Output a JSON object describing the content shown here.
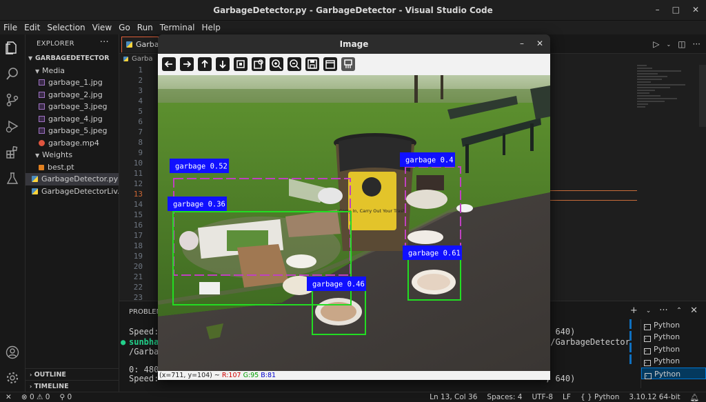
{
  "window": {
    "title": "GarbageDetector.py - GarbageDetector - Visual Studio Code",
    "controls": [
      "–",
      "□",
      "✕"
    ]
  },
  "menu": [
    "File",
    "Edit",
    "Selection",
    "View",
    "Go",
    "Run",
    "Terminal",
    "Help"
  ],
  "activity_bar": [
    "files-icon",
    "search-icon",
    "source-control-icon",
    "run-debug-icon",
    "extensions-icon",
    "testing-icon",
    "account-icon",
    "settings-gear-icon"
  ],
  "explorer": {
    "header": "EXPLORER",
    "root": "GARBAGEDETECTOR",
    "folders": [
      {
        "name": "Media",
        "files": [
          "garbage_1.jpg",
          "garbage_2.jpg",
          "garbage_3.jpeg",
          "garbage_4.jpg",
          "garbage_5.jpeg",
          "garbage.mp4"
        ]
      },
      {
        "name": "Weights",
        "files": [
          "best.pt"
        ]
      }
    ],
    "root_files": [
      "GarbageDetector.py",
      "GarbageDetectorLiv..."
    ],
    "sections": [
      "OUTLINE",
      "TIMELINE"
    ]
  },
  "editor": {
    "tab": "GarbageDetector.py",
    "tab_visible": "Garbag",
    "breadcrumb": "Garba",
    "line_numbers": [
      "1",
      "2",
      "3",
      "4",
      "5",
      "6",
      "7",
      "8",
      "9",
      "10",
      "11",
      "12",
      "13",
      "14",
      "15",
      "16",
      "17",
      "18",
      "19",
      "20",
      "21",
      "22",
      "23"
    ],
    "current_line": "13"
  },
  "panel": {
    "tab": "PROBLEM",
    "terminal_lines": [
      {
        "text": "Speed:",
        "color": "#cccccc"
      },
      {
        "text": "sunbha",
        "color": "#23d18b",
        "bold": true
      },
      {
        "text": "/Garba",
        "color": "#cccccc"
      },
      {
        "text": "",
        "color": "#cccccc"
      },
      {
        "text": "0: 480",
        "color": "#cccccc"
      },
      {
        "text": "Speed:",
        "color": "#cccccc"
      }
    ],
    "terminal_right": [
      ", 640)",
      "p/GarbageDetector",
      ", 640)"
    ],
    "terminals": [
      "Python",
      "Python",
      "Python",
      "Python",
      "Python"
    ]
  },
  "status": {
    "errors": "0",
    "warnings": "0",
    "ports": "0",
    "position": "Ln 13, Col 36",
    "spaces": "Spaces: 4",
    "encoding": "UTF-8",
    "eol": "LF",
    "language": "Python",
    "language_icon": "{ }",
    "interpreter": "3.10.12 64-bit"
  },
  "image_window": {
    "title": "Image",
    "controls": [
      "–",
      "✕"
    ],
    "toolbar": [
      "arrow-left-icon",
      "arrow-right-icon",
      "arrow-up-icon",
      "arrow-down-icon",
      "zoom-fit-icon",
      "zoom-select-icon",
      "zoom-in-icon",
      "zoom-out-icon",
      "save-icon",
      "properties-icon",
      "pan-icon"
    ],
    "status": {
      "coords": "(x=711, y=104) ~ ",
      "r": "R:107",
      "g": "G:95",
      "b": "B:81"
    },
    "bin_sign": "Carry In, Carry Out Your Trash",
    "detections": [
      {
        "label": "garbage 0.52",
        "box_color": "#c040c0"
      },
      {
        "label": "garbage 0.36",
        "box_color": "#22dd22"
      },
      {
        "label": "garbage 0.4",
        "box_color": "#c040c0"
      },
      {
        "label": "garbage 0.61",
        "box_color": "#22dd22"
      },
      {
        "label": "garbage 0.46",
        "box_color": "#22dd22"
      }
    ],
    "label_bg": "#1010ff"
  },
  "colors": {
    "accent": "#0078d4",
    "current_line": "#cc6633",
    "terminal_green": "#23d18b"
  }
}
